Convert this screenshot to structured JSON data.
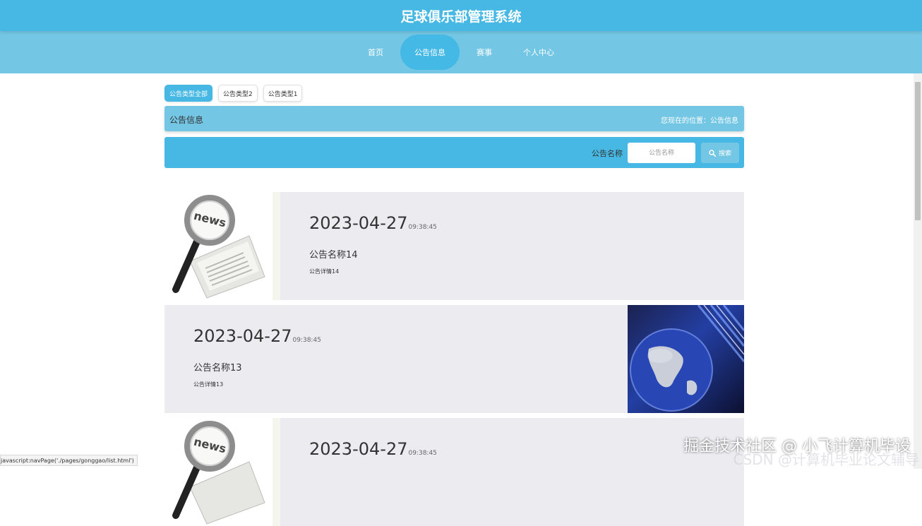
{
  "header": {
    "title": "足球俱乐部管理系统"
  },
  "nav": {
    "items": [
      {
        "label": "首页",
        "active": false
      },
      {
        "label": "公告信息",
        "active": true
      },
      {
        "label": "赛事",
        "active": false
      },
      {
        "label": "个人中心",
        "active": false
      }
    ]
  },
  "filters": {
    "tabs": [
      {
        "label": "公告类型全部",
        "active": true
      },
      {
        "label": "公告类型2",
        "active": false
      },
      {
        "label": "公告类型1",
        "active": false
      }
    ]
  },
  "section": {
    "title": "公告信息",
    "breadcrumb": "您现在的位置：公告信息"
  },
  "search": {
    "label": "公告名称",
    "placeholder": "公告名称",
    "button_label": "搜索"
  },
  "announcements": [
    {
      "date": "2023-04-27",
      "time": "09:38:45",
      "name": "公告名称14",
      "detail": "公告详情14",
      "thumbnail": "news-magnifier-image",
      "thumb_side": "left"
    },
    {
      "date": "2023-04-27",
      "time": "09:38:45",
      "name": "公告名称13",
      "detail": "公告详情13",
      "thumbnail": "globe-news-image",
      "thumb_side": "right"
    },
    {
      "date": "2023-04-27",
      "time": "09:38:45",
      "name": "",
      "detail": "",
      "thumbnail": "news-magnifier-image",
      "thumb_side": "left"
    }
  ],
  "status_bar": {
    "text": "javascript:navPage('./pages/gonggao/list.html')"
  },
  "watermark": {
    "text": "掘金技术社区 @ 小飞计算机毕设",
    "subtext": "CSDN @计算机毕业论文辅导"
  },
  "colors": {
    "primary": "#46b8e3",
    "secondary": "#73c6e4",
    "card_bg": "#ecebf0"
  }
}
